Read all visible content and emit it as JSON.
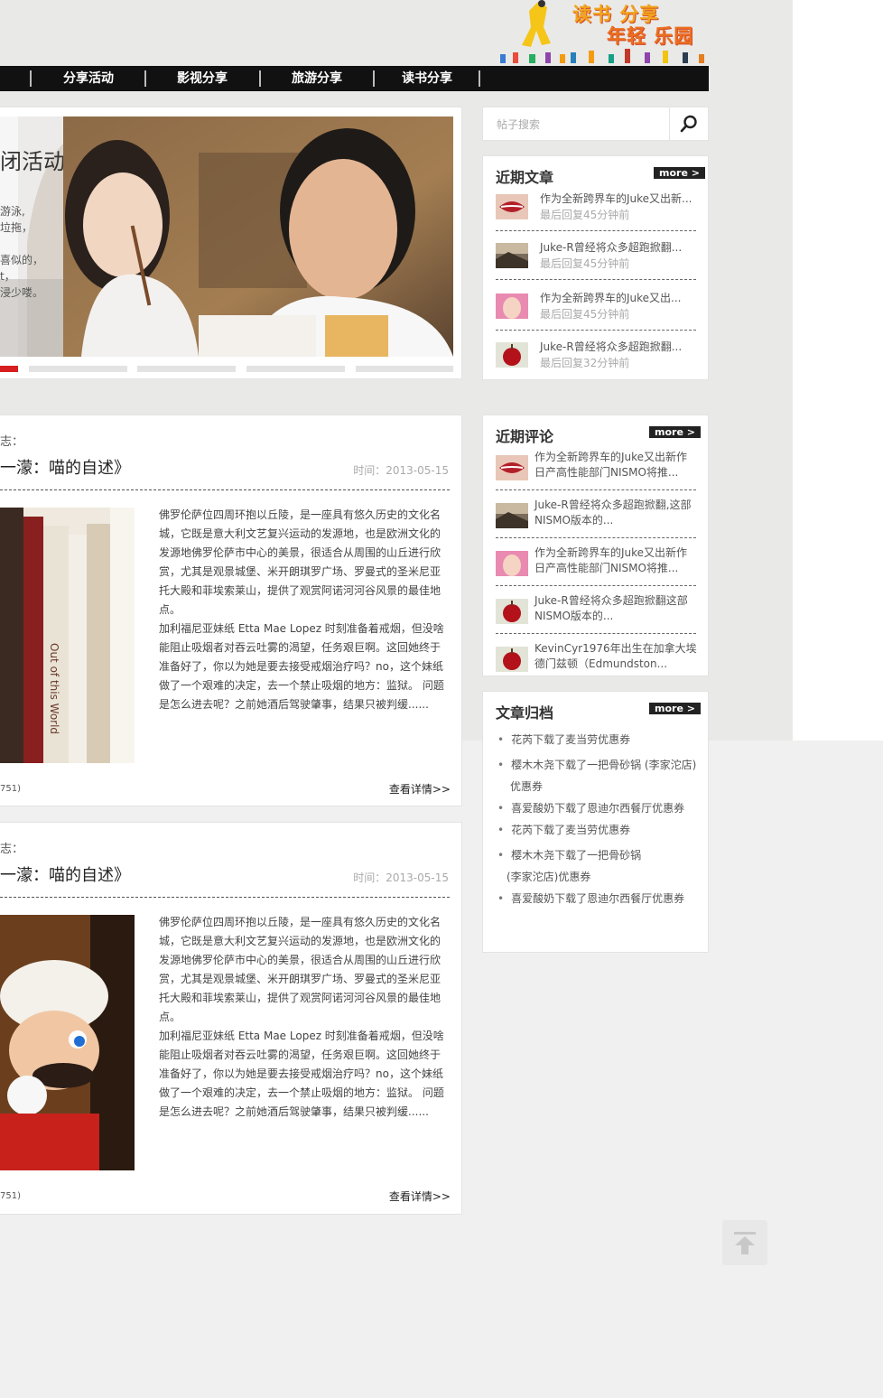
{
  "logo": {
    "line1": "读书 分享",
    "line2": "年轻 乐园"
  },
  "nav": {
    "items": [
      "分享活动",
      "影视分享",
      "旅游分享",
      "读书分享"
    ]
  },
  "slider": {
    "title": "闭活动",
    "lines": [
      "游泳,",
      "垃拖，",
      "喜似的，",
      "t，",
      "浸少喽。"
    ]
  },
  "search": {
    "placeholder": "帖子搜索"
  },
  "recent_articles": {
    "title": "近期文章",
    "more": "more >",
    "items": [
      {
        "title": "作为全新跨界车的Juke又出新...",
        "sub": "最后回复45分钟前"
      },
      {
        "title": "Juke-R曾经将众多超跑掀翻...",
        "sub": "最后回复45分钟前"
      },
      {
        "title": "作为全新跨界车的Juke又出...",
        "sub": "最后回复45分钟前"
      },
      {
        "title": "Juke-R曾经将众多超跑掀翻...",
        "sub": "最后回复32分钟前"
      }
    ]
  },
  "recent_comments": {
    "title": "近期评论",
    "more": "more >",
    "items": [
      {
        "text": "作为全新跨界车的Juke又出新作日产高性能部门NISMO将推..."
      },
      {
        "text": "Juke-R曾经将众多超跑掀翻,这部NISMO版本的..."
      },
      {
        "text": "作为全新跨界车的Juke又出新作日产高性能部门NISMO将推..."
      },
      {
        "text": "Juke-R曾经将众多超跑掀翻这部NISMO版本的..."
      },
      {
        "text": "KevinCyr1976年出生在加拿大埃德门兹顿（Edmundston..."
      }
    ]
  },
  "archive": {
    "title": "文章归档",
    "more": "more >",
    "items": [
      {
        "text": "花芮下载了麦当劳优惠券"
      },
      {
        "text": "樱木木尧下载了一把骨砂锅 (李家沱店)",
        "cont": "优惠券"
      },
      {
        "text": "喜爱酸奶下载了恩迪尔西餐厅优惠券"
      },
      {
        "text": "花芮下载了麦当劳优惠券"
      },
      {
        "text": "樱木木尧下载了一把骨砂锅",
        "cont": "(李家沱店)优惠券"
      },
      {
        "text": "喜爱酸奶下载了恩迪尔西餐厅优惠券"
      }
    ]
  },
  "posts": [
    {
      "label": "志：",
      "title": "一濛：喵的自述》",
      "date": "时间：2013-05-15",
      "para1": "佛罗伦萨位四周环抱以丘陵，是一座具有悠久历史的文化名城，它既是意大利文艺复兴运动的发源地，也是欧洲文化的发源地佛罗伦萨市中心的美景，很适合从周围的山丘进行欣赏，尤其是观景城堡、米开朗琪罗广场、罗曼式的圣米尼亚托大殿和菲埃索莱山，提供了观赏阿诺河河谷风景的最佳地点。",
      "para2": "加利福尼亚妹纸 Etta Mae Lopez 时刻准备着戒烟，但没啥能阻止吸烟者对吞云吐雾的渴望，任务艰巨啊。这回她终于准备好了，你以为她是要去接受戒烟治疗吗？no，这个妹纸做了一个艰难的决定，去一个禁止吸烟的地方：监狱。 问题是怎么进去呢？之前她酒后驾驶肇事，结果只被判缓......",
      "meta": "751)",
      "more": "查看详情>>"
    },
    {
      "label": "志：",
      "title": "一濛：喵的自述》",
      "date": "时间：2013-05-15",
      "para1": "佛罗伦萨位四周环抱以丘陵，是一座具有悠久历史的文化名城，它既是意大利文艺复兴运动的发源地，也是欧洲文化的发源地佛罗伦萨市中心的美景，很适合从周围的山丘进行欣赏，尤其是观景城堡、米开朗琪罗广场、罗曼式的圣米尼亚托大殿和菲埃索莱山，提供了观赏阿诺河河谷风景的最佳地点。",
      "para2": "加利福尼亚妹纸 Etta Mae Lopez 时刻准备着戒烟，但没啥能阻止吸烟者对吞云吐雾的渴望，任务艰巨啊。这回她终于准备好了，你以为她是要去接受戒烟治疗吗？no，这个妹纸做了一个艰难的决定，去一个禁止吸烟的地方：监狱。 问题是怎么进去呢？之前她酒后驾驶肇事，结果只被判缓......",
      "meta": "751)",
      "more": "查看详情>>"
    }
  ],
  "colors": {
    "accent": "#d71f1f",
    "nav_bg": "#111111"
  }
}
